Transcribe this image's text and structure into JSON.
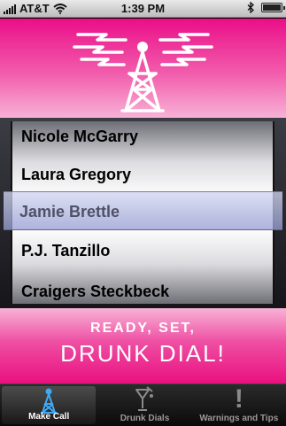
{
  "status_bar": {
    "carrier": "AT&T",
    "time": "1:39 PM"
  },
  "picker": {
    "items": [
      "Nicole McGarry",
      "Laura Gregory",
      "Jamie Brettle",
      "P.J. Tanzillo",
      "Craigers Steckbeck"
    ],
    "selected": "Jamie Brettle"
  },
  "dial_button": {
    "line1": "READY, SET,",
    "line2": "DRUNK DIAL!"
  },
  "tabs": [
    {
      "label": "Make Call",
      "icon": "tower-icon",
      "active": true
    },
    {
      "label": "Drunk Dials",
      "icon": "cocktail-phone-icon",
      "active": false
    },
    {
      "label": "Warnings and Tips",
      "icon": "exclamation-icon",
      "active": false
    }
  ],
  "colors": {
    "accent": "#ea0e88",
    "accent_light": "#f7b2d6",
    "tabbar": "#111111"
  }
}
